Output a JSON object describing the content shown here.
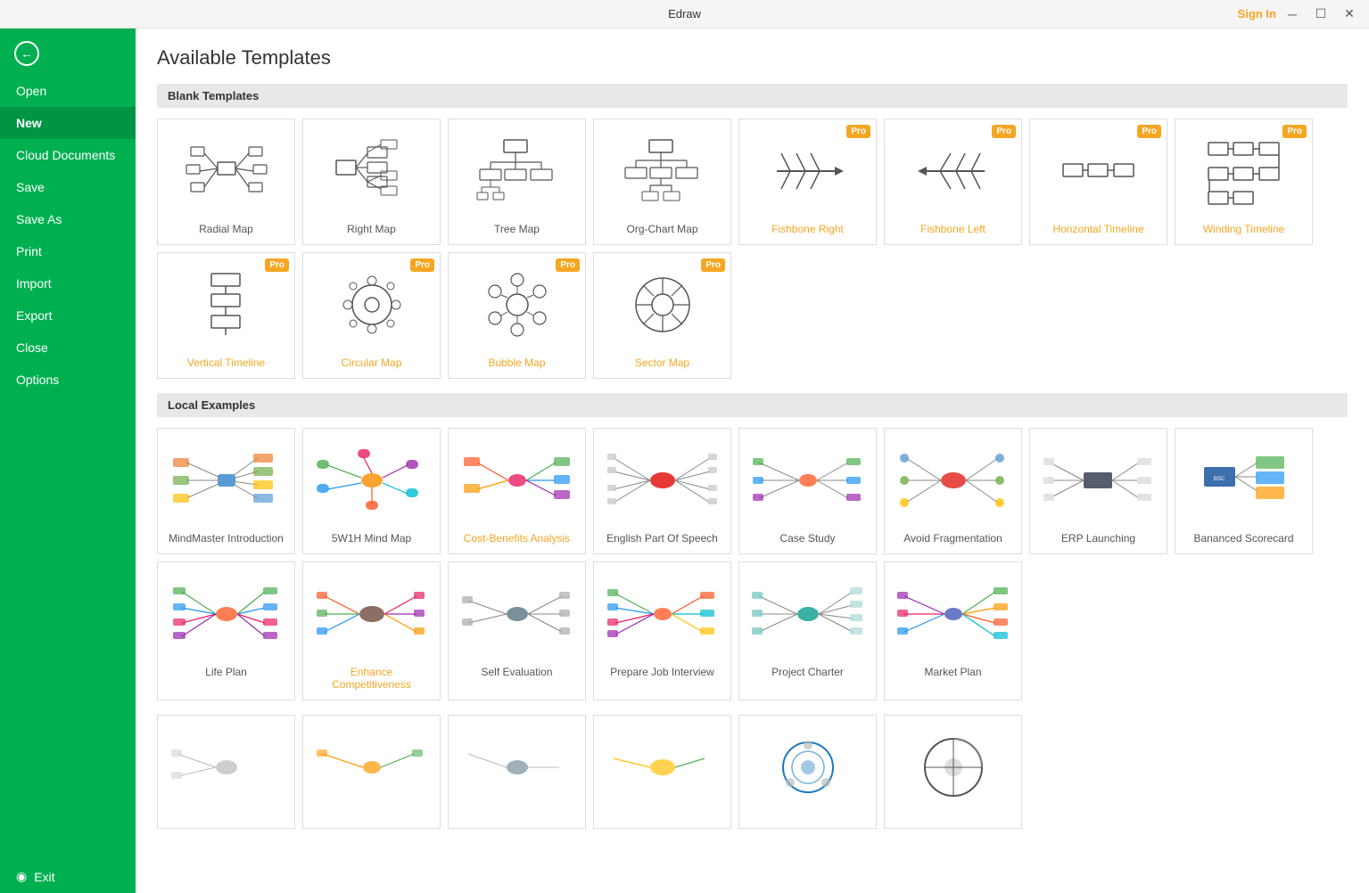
{
  "titleBar": {
    "title": "Edraw",
    "signIn": "Sign In",
    "controls": [
      "─",
      "☐",
      "✕"
    ]
  },
  "sidebar": {
    "backLabel": "",
    "items": [
      {
        "id": "open",
        "label": "Open",
        "active": false
      },
      {
        "id": "new",
        "label": "New",
        "active": true
      },
      {
        "id": "cloud",
        "label": "Cloud Documents",
        "active": false
      },
      {
        "id": "save",
        "label": "Save",
        "active": false
      },
      {
        "id": "saveas",
        "label": "Save As",
        "active": false
      },
      {
        "id": "print",
        "label": "Print",
        "active": false
      },
      {
        "id": "import",
        "label": "Import",
        "active": false
      },
      {
        "id": "export",
        "label": "Export",
        "active": false
      },
      {
        "id": "close",
        "label": "Close",
        "active": false
      },
      {
        "id": "options",
        "label": "Options",
        "active": false
      },
      {
        "id": "exit",
        "label": "Exit",
        "active": false,
        "isExit": true
      }
    ]
  },
  "main": {
    "pageTitle": "Available Templates",
    "blankSection": {
      "header": "Blank Templates",
      "templates": [
        {
          "id": "radial-map",
          "label": "Radial Map",
          "pro": false
        },
        {
          "id": "right-map",
          "label": "Right Map",
          "pro": false
        },
        {
          "id": "tree-map",
          "label": "Tree Map",
          "pro": false
        },
        {
          "id": "org-chart-map",
          "label": "Org-Chart Map",
          "pro": false
        },
        {
          "id": "fishbone-right",
          "label": "Fishbone Right",
          "pro": true
        },
        {
          "id": "fishbone-left",
          "label": "Fishbone Left",
          "pro": true
        },
        {
          "id": "horizontal-timeline",
          "label": "Horizontal Timeline",
          "pro": true
        },
        {
          "id": "winding-timeline",
          "label": "Winding Timeline",
          "pro": true
        },
        {
          "id": "vertical-timeline",
          "label": "Vertical Timeline",
          "pro": true
        },
        {
          "id": "circular-map",
          "label": "Circular Map",
          "pro": true
        },
        {
          "id": "bubble-map",
          "label": "Bubble Map",
          "pro": true
        },
        {
          "id": "sector-map",
          "label": "Sector Map",
          "pro": true
        }
      ]
    },
    "examplesSection": {
      "header": "Local Examples",
      "examples": [
        {
          "id": "mindmaster-intro",
          "label": "MindMaster Introduction"
        },
        {
          "id": "5w1h-mind-map",
          "label": "5W1H Mind Map"
        },
        {
          "id": "cost-benefits",
          "label": "Cost-Benefits Analysis"
        },
        {
          "id": "english-part",
          "label": "English Part Of Speech"
        },
        {
          "id": "case-study",
          "label": "Case Study"
        },
        {
          "id": "avoid-fragmentation",
          "label": "Avoid Fragmentation"
        },
        {
          "id": "erp-launching",
          "label": "ERP Launching"
        },
        {
          "id": "balanced-scorecard",
          "label": "Bananced Scorecard"
        },
        {
          "id": "life-plan",
          "label": "Life Plan"
        },
        {
          "id": "enhance-competitiveness",
          "label": "Enhance Competitiveness"
        },
        {
          "id": "self-evaluation",
          "label": "Self Evaluation"
        },
        {
          "id": "prepare-job-interview",
          "label": "Prepare Job Interview"
        },
        {
          "id": "project-charter",
          "label": "Project Charter"
        },
        {
          "id": "market-plan",
          "label": "Market Plan"
        }
      ]
    }
  }
}
